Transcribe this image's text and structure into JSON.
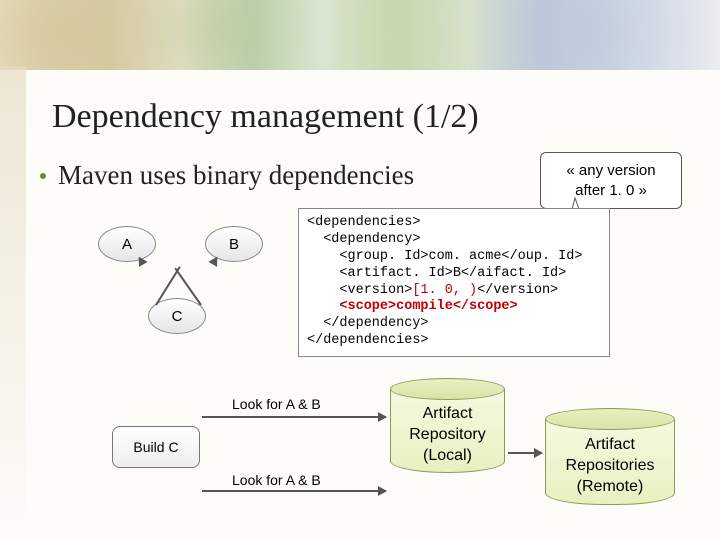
{
  "slide": {
    "title": "Dependency management (1/2)",
    "bullet": "Maven uses binary dependencies"
  },
  "nodes": {
    "a": "A",
    "b": "B",
    "c": "C"
  },
  "callout": {
    "line1": "« any version",
    "line2": "after 1. 0 »"
  },
  "code": {
    "l1": "<dependencies>",
    "l2": "  <dependency>",
    "l3a": "    <group. Id>com. acme</",
    "l3b": "oup. Id>",
    "l4a": "    <artifact. Id>B</a",
    "l4b": "ifact. Id>",
    "l5a": "    <version>",
    "l5b": "[1. 0, )",
    "l5c": "</version>",
    "l6a": "    ",
    "l6b": "<scope>compile</scope>",
    "l7": "  </dependency>",
    "l8": "</dependencies>"
  },
  "build": {
    "label": "Build C",
    "lookup": "Look for A & B"
  },
  "repos": {
    "local": "Artifact\nRepository\n(Local)",
    "remote": "Artifact\nRepositories\n(Remote)"
  }
}
